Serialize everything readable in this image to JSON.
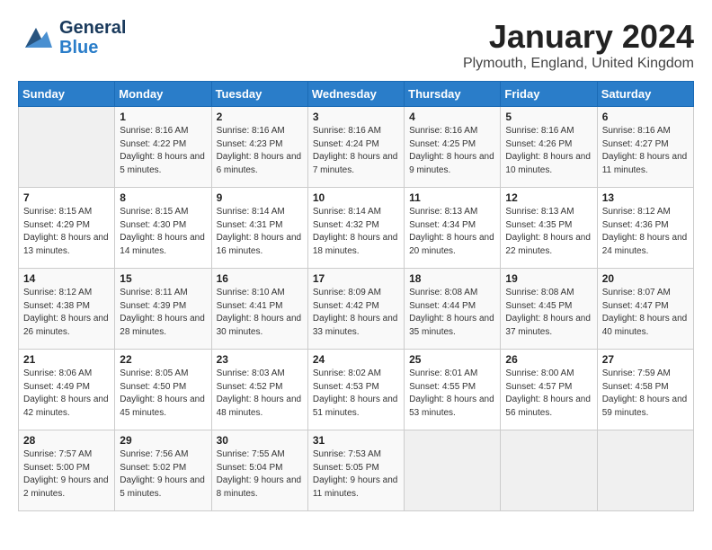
{
  "header": {
    "logo_general": "General",
    "logo_blue": "Blue",
    "month": "January 2024",
    "location": "Plymouth, England, United Kingdom"
  },
  "days_of_week": [
    "Sunday",
    "Monday",
    "Tuesday",
    "Wednesday",
    "Thursday",
    "Friday",
    "Saturday"
  ],
  "weeks": [
    [
      {
        "day": "",
        "sunrise": "",
        "sunset": "",
        "daylight": "",
        "empty": true
      },
      {
        "day": "1",
        "sunrise": "Sunrise: 8:16 AM",
        "sunset": "Sunset: 4:22 PM",
        "daylight": "Daylight: 8 hours and 5 minutes."
      },
      {
        "day": "2",
        "sunrise": "Sunrise: 8:16 AM",
        "sunset": "Sunset: 4:23 PM",
        "daylight": "Daylight: 8 hours and 6 minutes."
      },
      {
        "day": "3",
        "sunrise": "Sunrise: 8:16 AM",
        "sunset": "Sunset: 4:24 PM",
        "daylight": "Daylight: 8 hours and 7 minutes."
      },
      {
        "day": "4",
        "sunrise": "Sunrise: 8:16 AM",
        "sunset": "Sunset: 4:25 PM",
        "daylight": "Daylight: 8 hours and 9 minutes."
      },
      {
        "day": "5",
        "sunrise": "Sunrise: 8:16 AM",
        "sunset": "Sunset: 4:26 PM",
        "daylight": "Daylight: 8 hours and 10 minutes."
      },
      {
        "day": "6",
        "sunrise": "Sunrise: 8:16 AM",
        "sunset": "Sunset: 4:27 PM",
        "daylight": "Daylight: 8 hours and 11 minutes."
      }
    ],
    [
      {
        "day": "7",
        "sunrise": "Sunrise: 8:15 AM",
        "sunset": "Sunset: 4:29 PM",
        "daylight": "Daylight: 8 hours and 13 minutes."
      },
      {
        "day": "8",
        "sunrise": "Sunrise: 8:15 AM",
        "sunset": "Sunset: 4:30 PM",
        "daylight": "Daylight: 8 hours and 14 minutes."
      },
      {
        "day": "9",
        "sunrise": "Sunrise: 8:14 AM",
        "sunset": "Sunset: 4:31 PM",
        "daylight": "Daylight: 8 hours and 16 minutes."
      },
      {
        "day": "10",
        "sunrise": "Sunrise: 8:14 AM",
        "sunset": "Sunset: 4:32 PM",
        "daylight": "Daylight: 8 hours and 18 minutes."
      },
      {
        "day": "11",
        "sunrise": "Sunrise: 8:13 AM",
        "sunset": "Sunset: 4:34 PM",
        "daylight": "Daylight: 8 hours and 20 minutes."
      },
      {
        "day": "12",
        "sunrise": "Sunrise: 8:13 AM",
        "sunset": "Sunset: 4:35 PM",
        "daylight": "Daylight: 8 hours and 22 minutes."
      },
      {
        "day": "13",
        "sunrise": "Sunrise: 8:12 AM",
        "sunset": "Sunset: 4:36 PM",
        "daylight": "Daylight: 8 hours and 24 minutes."
      }
    ],
    [
      {
        "day": "14",
        "sunrise": "Sunrise: 8:12 AM",
        "sunset": "Sunset: 4:38 PM",
        "daylight": "Daylight: 8 hours and 26 minutes."
      },
      {
        "day": "15",
        "sunrise": "Sunrise: 8:11 AM",
        "sunset": "Sunset: 4:39 PM",
        "daylight": "Daylight: 8 hours and 28 minutes."
      },
      {
        "day": "16",
        "sunrise": "Sunrise: 8:10 AM",
        "sunset": "Sunset: 4:41 PM",
        "daylight": "Daylight: 8 hours and 30 minutes."
      },
      {
        "day": "17",
        "sunrise": "Sunrise: 8:09 AM",
        "sunset": "Sunset: 4:42 PM",
        "daylight": "Daylight: 8 hours and 33 minutes."
      },
      {
        "day": "18",
        "sunrise": "Sunrise: 8:08 AM",
        "sunset": "Sunset: 4:44 PM",
        "daylight": "Daylight: 8 hours and 35 minutes."
      },
      {
        "day": "19",
        "sunrise": "Sunrise: 8:08 AM",
        "sunset": "Sunset: 4:45 PM",
        "daylight": "Daylight: 8 hours and 37 minutes."
      },
      {
        "day": "20",
        "sunrise": "Sunrise: 8:07 AM",
        "sunset": "Sunset: 4:47 PM",
        "daylight": "Daylight: 8 hours and 40 minutes."
      }
    ],
    [
      {
        "day": "21",
        "sunrise": "Sunrise: 8:06 AM",
        "sunset": "Sunset: 4:49 PM",
        "daylight": "Daylight: 8 hours and 42 minutes."
      },
      {
        "day": "22",
        "sunrise": "Sunrise: 8:05 AM",
        "sunset": "Sunset: 4:50 PM",
        "daylight": "Daylight: 8 hours and 45 minutes."
      },
      {
        "day": "23",
        "sunrise": "Sunrise: 8:03 AM",
        "sunset": "Sunset: 4:52 PM",
        "daylight": "Daylight: 8 hours and 48 minutes."
      },
      {
        "day": "24",
        "sunrise": "Sunrise: 8:02 AM",
        "sunset": "Sunset: 4:53 PM",
        "daylight": "Daylight: 8 hours and 51 minutes."
      },
      {
        "day": "25",
        "sunrise": "Sunrise: 8:01 AM",
        "sunset": "Sunset: 4:55 PM",
        "daylight": "Daylight: 8 hours and 53 minutes."
      },
      {
        "day": "26",
        "sunrise": "Sunrise: 8:00 AM",
        "sunset": "Sunset: 4:57 PM",
        "daylight": "Daylight: 8 hours and 56 minutes."
      },
      {
        "day": "27",
        "sunrise": "Sunrise: 7:59 AM",
        "sunset": "Sunset: 4:58 PM",
        "daylight": "Daylight: 8 hours and 59 minutes."
      }
    ],
    [
      {
        "day": "28",
        "sunrise": "Sunrise: 7:57 AM",
        "sunset": "Sunset: 5:00 PM",
        "daylight": "Daylight: 9 hours and 2 minutes."
      },
      {
        "day": "29",
        "sunrise": "Sunrise: 7:56 AM",
        "sunset": "Sunset: 5:02 PM",
        "daylight": "Daylight: 9 hours and 5 minutes."
      },
      {
        "day": "30",
        "sunrise": "Sunrise: 7:55 AM",
        "sunset": "Sunset: 5:04 PM",
        "daylight": "Daylight: 9 hours and 8 minutes."
      },
      {
        "day": "31",
        "sunrise": "Sunrise: 7:53 AM",
        "sunset": "Sunset: 5:05 PM",
        "daylight": "Daylight: 9 hours and 11 minutes."
      },
      {
        "day": "",
        "sunrise": "",
        "sunset": "",
        "daylight": "",
        "empty": true
      },
      {
        "day": "",
        "sunrise": "",
        "sunset": "",
        "daylight": "",
        "empty": true
      },
      {
        "day": "",
        "sunrise": "",
        "sunset": "",
        "daylight": "",
        "empty": true
      }
    ]
  ]
}
